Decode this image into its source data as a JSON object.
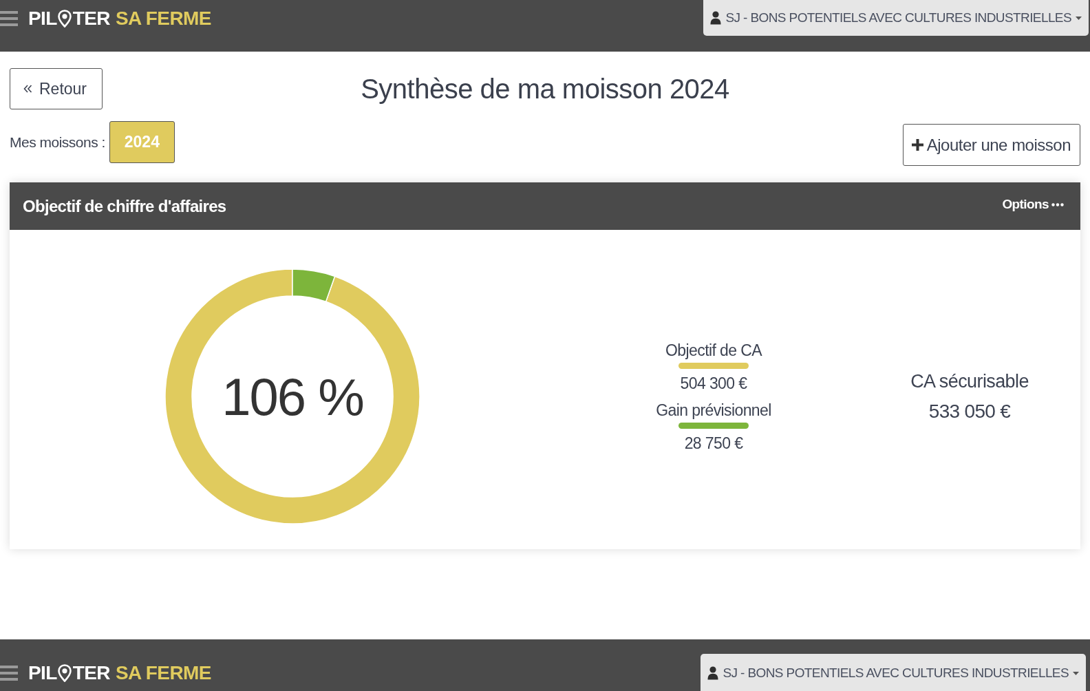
{
  "top_bar": {
    "logo": {
      "first": "PIL",
      "second": "TER",
      "accent": "SA FERME"
    },
    "farm_selector": {
      "label": "SJ - BONS POTENTIELS AVEC CULTURES INDUSTRIELLES"
    }
  },
  "back_button": {
    "label": "Retour"
  },
  "page_title": "Synthèse de ma moisson 2024",
  "harvests": {
    "label": "Mes moissons :",
    "years": [
      {
        "label": "2024",
        "selected": true
      }
    ]
  },
  "add_button": {
    "label": "Ajouter une moisson"
  },
  "panel": {
    "title": "Objectif de chiffre d'affaires",
    "options": "Options",
    "chart_data": {
      "type": "donut",
      "values": [
        94.6,
        5.4
      ]
    },
    "center_label": "106 %",
    "legend": [
      {
        "label": "Objectif de CA",
        "color": "#e0cb5e",
        "value": "504 300 €"
      },
      {
        "label": "Gain prévisionnel",
        "color": "#7db53b",
        "value": "28 750 €"
      }
    ],
    "total": {
      "label": "CA sécurisable",
      "value": "533 050 €"
    }
  },
  "bottom_bar": {
    "logo": {
      "first": "PIL",
      "second": "TER",
      "accent": "SA FERME"
    },
    "farm_selector": {
      "label": "SJ - BONS POTENTIELS AVEC CULTURES INDUSTRIELLES"
    }
  }
}
